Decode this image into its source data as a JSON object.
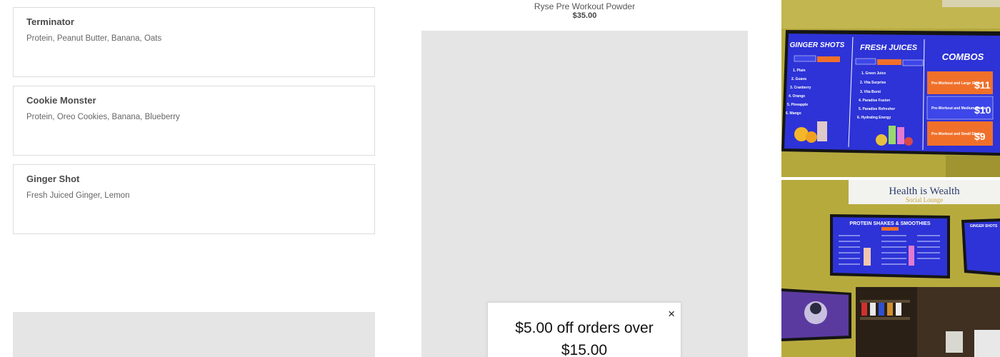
{
  "menu_items": [
    {
      "name": "Terminator",
      "ingredients": "Protein, Peanut Butter, Banana, Oats"
    },
    {
      "name": "Cookie Monster",
      "ingredients": "Protein, Oreo Cookies, Banana, Blueberry"
    },
    {
      "name": "Ginger Shot",
      "ingredients": "Fresh Juiced Ginger, Lemon"
    }
  ],
  "product": {
    "name": "Ryse Pre Workout Powder",
    "price": "$35.00"
  },
  "promo": {
    "headline": "$5.00 off orders over $15.00",
    "close_icon": "×"
  },
  "photos": {
    "menu_board": {
      "sections": [
        "GINGER SHOTS",
        "FRESH JUICES",
        "COMBOS"
      ],
      "ginger_sizes": [
        "Single $4",
        "Double $6"
      ],
      "juice_sizes": [
        "Small $4",
        "Medium $6",
        "Large $8"
      ],
      "ginger_list": [
        "1. Plain",
        "2. Guava",
        "3. Cranberry",
        "4. Orange",
        "5. Pineapple",
        "6. Mango"
      ],
      "juice_list": [
        "1. Green Juice",
        "2. Vita Surprise",
        "3. Vita Burst",
        "4. Paradise Fusion",
        "5. Paradise Refresher",
        "6. Hydrating Energy"
      ],
      "combos": [
        {
          "label": "Pre-Workout and Large Shake",
          "price": "$11"
        },
        {
          "label": "Pre-Workout and Medium Shake",
          "price": "$10"
        },
        {
          "label": "Pre-Workout and Small Shake",
          "price": "$9"
        }
      ]
    },
    "store": {
      "sign_line1": "Health is Wealth",
      "sign_line2": "Social Lounge",
      "board_title": "PROTEIN SHAKES & SMOOTHIES",
      "side_board": "GINGER SHOTS"
    },
    "colors": {
      "board_blue": "#2d33d6",
      "combo_orange": "#f0702a",
      "wall_yellow": "#b8a93a"
    }
  }
}
